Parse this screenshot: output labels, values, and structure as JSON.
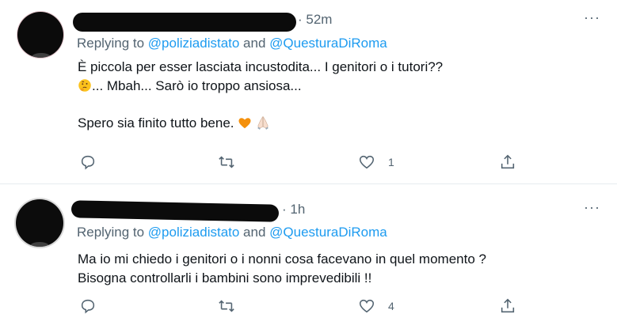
{
  "tweets": [
    {
      "time": "52m",
      "reply_prefix": "Replying to ",
      "mention1": "@poliziadistato",
      "and": " and ",
      "mention2": "@QuesturaDiRoma",
      "line1": "È piccola per esser lasciata incustodita... I genitori o i tutori??",
      "line2": "... Mbah... Sarò io troppo ansiosa...",
      "line3": "Spero sia finito tutto bene.",
      "emojis": [
        "thinking-face",
        "orange-heart",
        "folded-hands"
      ],
      "likes": "1",
      "more": "···"
    },
    {
      "time": "1h",
      "reply_prefix": "Replying to ",
      "mention1": "@poliziadistato",
      "and": " and ",
      "mention2": "@QuesturaDiRoma",
      "line1": "Ma io mi chiedo i genitori o i nonni cosa facevano in quel momento ?",
      "line2": "Bisogna controllarli i bambini sono imprevedibili !!",
      "likes": "4",
      "more": "···"
    }
  ],
  "colors": {
    "mention": "#1d9bf0",
    "muted": "#536471",
    "text": "#0f1419",
    "separator": "#e6ecf0"
  }
}
